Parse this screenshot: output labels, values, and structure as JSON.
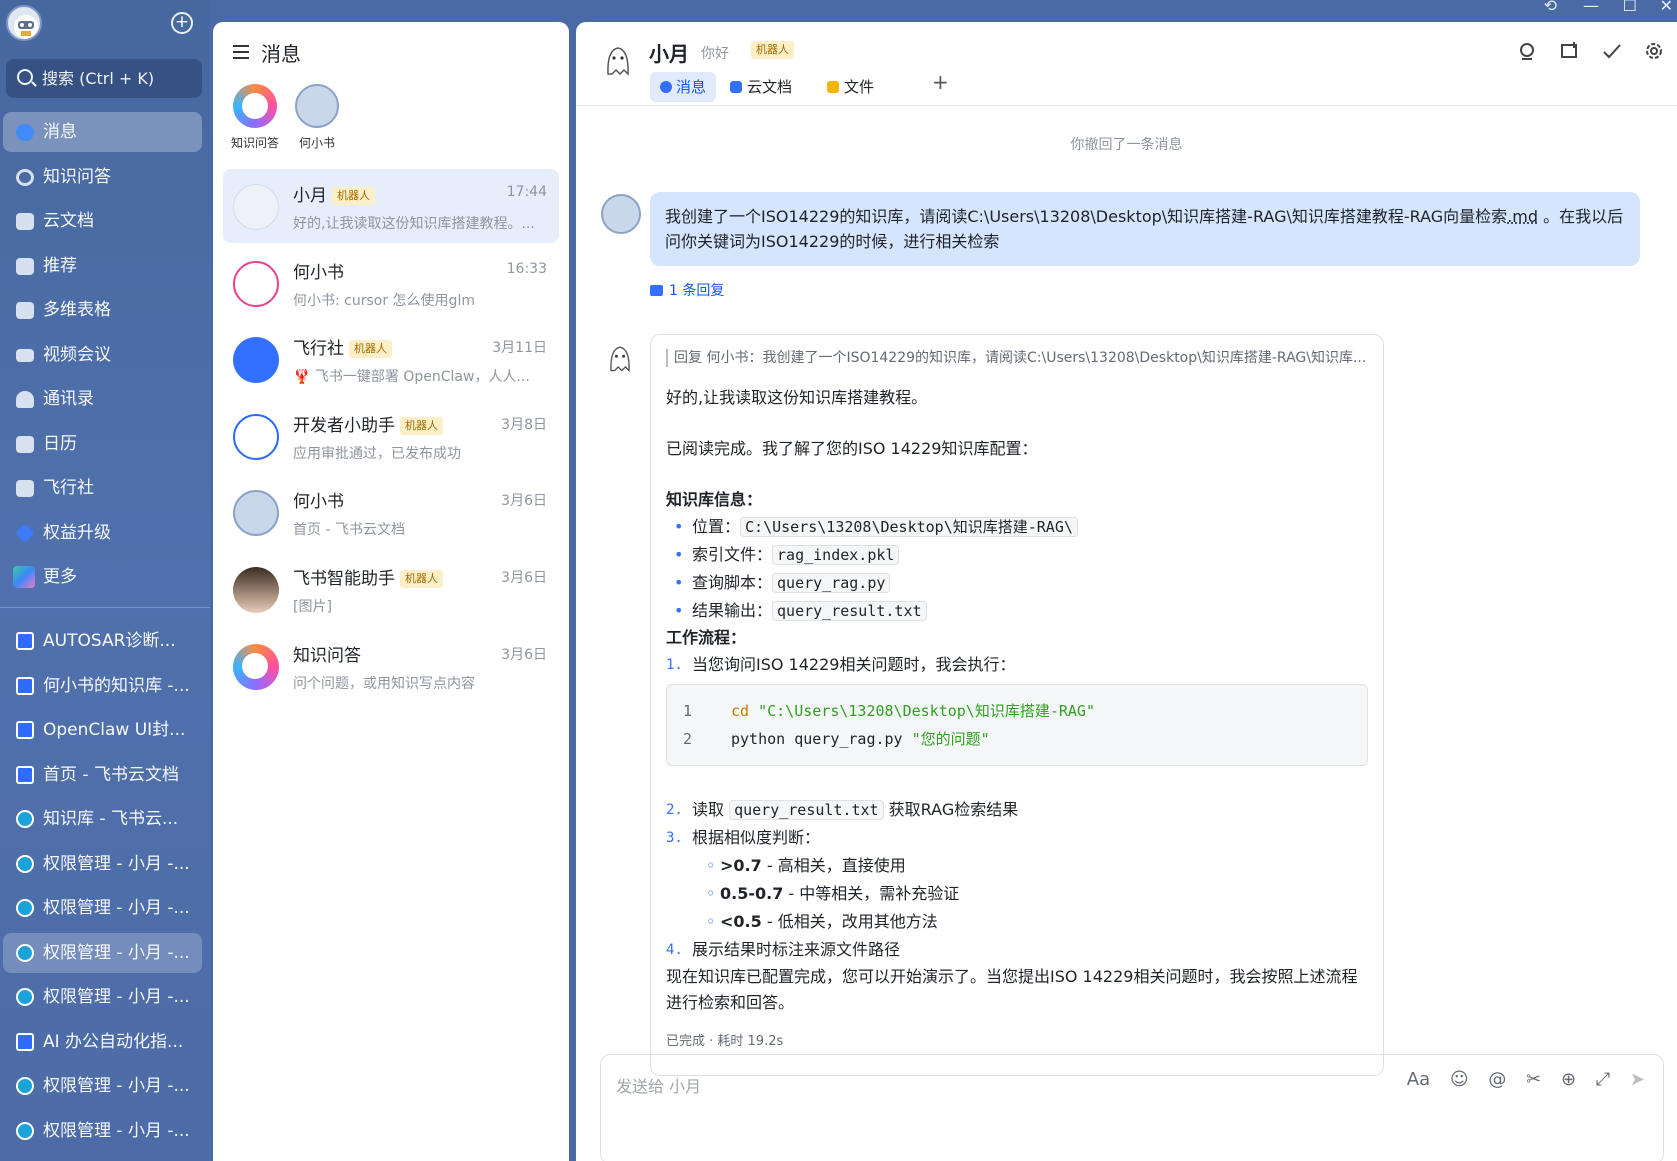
{
  "sidebar": {
    "search_placeholder": "搜索 (Ctrl + K)",
    "nav": [
      {
        "label": "消息",
        "icon": "chat-bubble-icon"
      },
      {
        "label": "知识问答",
        "icon": "knowledge-qa-icon"
      },
      {
        "label": "云文档",
        "icon": "cloud-doc-icon"
      },
      {
        "label": "推荐",
        "icon": "recommend-icon"
      },
      {
        "label": "多维表格",
        "icon": "base-table-icon"
      },
      {
        "label": "视频会议",
        "icon": "video-meeting-icon"
      },
      {
        "label": "通讯录",
        "icon": "contacts-icon"
      },
      {
        "label": "日历",
        "icon": "calendar-icon"
      },
      {
        "label": "飞行社",
        "icon": "flight-club-icon"
      },
      {
        "label": "权益升级",
        "icon": "diamond-icon"
      },
      {
        "label": "更多",
        "icon": "more-apps-icon"
      }
    ],
    "docs": [
      {
        "label": "AUTOSAR诊断...",
        "type": "doc"
      },
      {
        "label": "何小书的知识库 -...",
        "type": "doc"
      },
      {
        "label": "OpenClaw UI封...",
        "type": "doc"
      },
      {
        "label": "首页 - 飞书云文档",
        "type": "doc"
      },
      {
        "label": "知识库 - 飞书云...",
        "type": "wiki"
      },
      {
        "label": "权限管理 - 小月 -...",
        "type": "wiki"
      },
      {
        "label": "权限管理 - 小月 -...",
        "type": "wiki"
      },
      {
        "label": "权限管理 - 小月 -...",
        "type": "wiki"
      },
      {
        "label": "权限管理 - 小月 -...",
        "type": "wiki"
      },
      {
        "label": "AI 办公自动化指...",
        "type": "doc"
      },
      {
        "label": "权限管理 - 小月 -...",
        "type": "wiki"
      },
      {
        "label": "权限管理 - 小月 -...",
        "type": "wiki"
      }
    ]
  },
  "chat_panel": {
    "title": "消息",
    "pinned": [
      {
        "label": "知识问答"
      },
      {
        "label": "何小书"
      }
    ],
    "bot_tag": "机器人",
    "chats": [
      {
        "name": "小月",
        "bot": true,
        "time": "17:44",
        "preview": "好的,让我读取这份知识库搭建教程。..."
      },
      {
        "name": "何小书",
        "bot": false,
        "time": "16:33",
        "preview": "何小书: cursor 怎么使用glm"
      },
      {
        "name": "飞行社",
        "bot": true,
        "time": "3月11日",
        "preview": "🦞 飞书一键部署 OpenClaw，人人..."
      },
      {
        "name": "开发者小助手",
        "bot": true,
        "time": "3月8日",
        "preview": "应用审批通过，已发布成功"
      },
      {
        "name": "何小书",
        "bot": false,
        "time": "3月6日",
        "preview": "首页 - 飞书云文档"
      },
      {
        "name": "飞书智能助手",
        "bot": true,
        "time": "3月6日",
        "preview": "[图片]"
      },
      {
        "name": "知识问答",
        "bot": false,
        "time": "3月6日",
        "preview": "问个问题，或用知识写点内容"
      }
    ]
  },
  "conversation": {
    "name": "小月",
    "greeting": "你好",
    "bot_tag": "机器人",
    "tabs": [
      {
        "label": "消息"
      },
      {
        "label": "云文档"
      },
      {
        "label": "文件"
      }
    ],
    "tab_add": "+",
    "recall_notice": "你撤回了一条消息",
    "user_message": "我创建了一个ISO14229的知识库，请阅读C:\\Users\\13208\\Desktop\\知识库搭建-RAG\\知识库搭建教程-RAG向量检索",
    "user_message_link": ".md",
    "user_message_tail": " 。在我以后问你关键词为ISO14229的时候，进行相关检索",
    "reply_count": "1 条回复",
    "reply": {
      "quote": "回复 何小书：我创建了一个ISO14229的知识库，请阅读C:\\Users\\13208\\Desktop\\知识库搭建-RAG\\知识库...",
      "line1": "好的,让我读取这份知识库搭建教程。",
      "line2": "已阅读完成。我了解了您的ISO 14229知识库配置：",
      "info_title": "知识库信息：",
      "info": [
        {
          "label": "位置：",
          "code": "C:\\Users\\13208\\Desktop\\知识库搭建-RAG\\"
        },
        {
          "label": "索引文件：",
          "code": "rag_index.pkl"
        },
        {
          "label": "查询脚本：",
          "code": "query_rag.py"
        },
        {
          "label": "结果输出：",
          "code": "query_result.txt"
        }
      ],
      "flow_title": "工作流程：",
      "step1": "当您询问ISO 14229相关问题时，我会执行：",
      "code_lines": [
        {
          "n": "1",
          "kw": "cd",
          "rest": "",
          "str": "\"C:\\Users\\13208\\Desktop\\知识库搭建-RAG\""
        },
        {
          "n": "2",
          "kw": "",
          "rest": "python query_rag.py ",
          "str": "\"您的问题\""
        }
      ],
      "step2_pre": "读取 ",
      "step2_code": "query_result.txt",
      "step2_post": " 获取RAG检索结果",
      "step3": "根据相似度判断：",
      "thresholds": [
        {
          "bold": ">0.7",
          "text": " - 高相关，直接使用"
        },
        {
          "bold": "0.5-0.7",
          "text": " - 中等相关，需补充验证"
        },
        {
          "bold": "<0.5",
          "text": " - 低相关，改用其他方法"
        }
      ],
      "step4": "展示结果时标注来源文件路径",
      "closing": "现在知识库已配置完成，您可以开始演示了。当您提出ISO 14229相关问题时，我会按照上述流程进行检索和回答。",
      "status": "已完成 · 耗时 19.2s"
    },
    "input_placeholder": "发送给 小月"
  },
  "colors": {
    "accent": "#3370ff",
    "bubble": "#d5e5fd",
    "sidebar": "#4a6aa6"
  }
}
